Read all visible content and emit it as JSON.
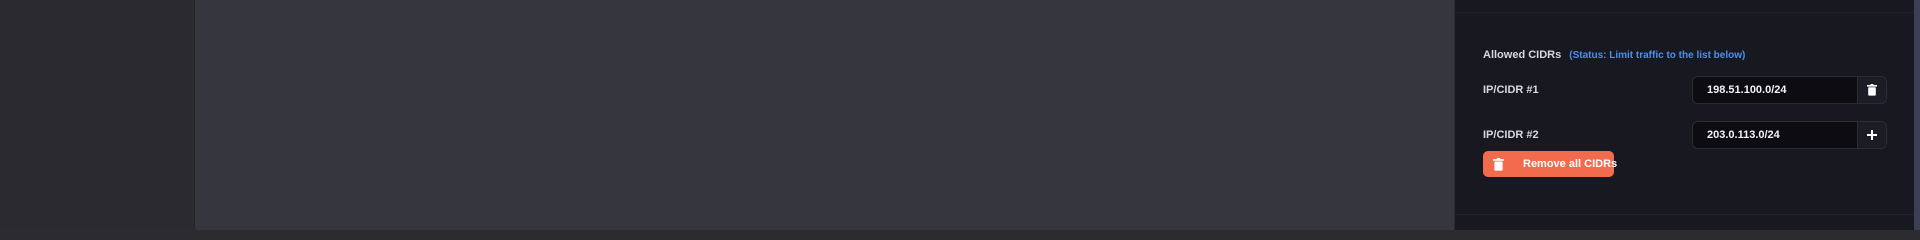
{
  "allowed_cidrs": {
    "title": "Allowed CIDRs",
    "status": "(Status: Limit traffic to the list below)",
    "rows": [
      {
        "label": "IP/CIDR #1",
        "value": "198.51.100.0/24",
        "action_icon": "trash-icon"
      },
      {
        "label": "IP/CIDR #2",
        "value": "203.0.113.0/24",
        "action_icon": "plus-icon"
      }
    ],
    "remove_all_label": "Remove all CIDRs"
  },
  "colors": {
    "accent_status": "#4c8ff0",
    "danger_button": "#f26b4d",
    "panel_bg": "#181820",
    "canvas_bg": "#36363f"
  }
}
